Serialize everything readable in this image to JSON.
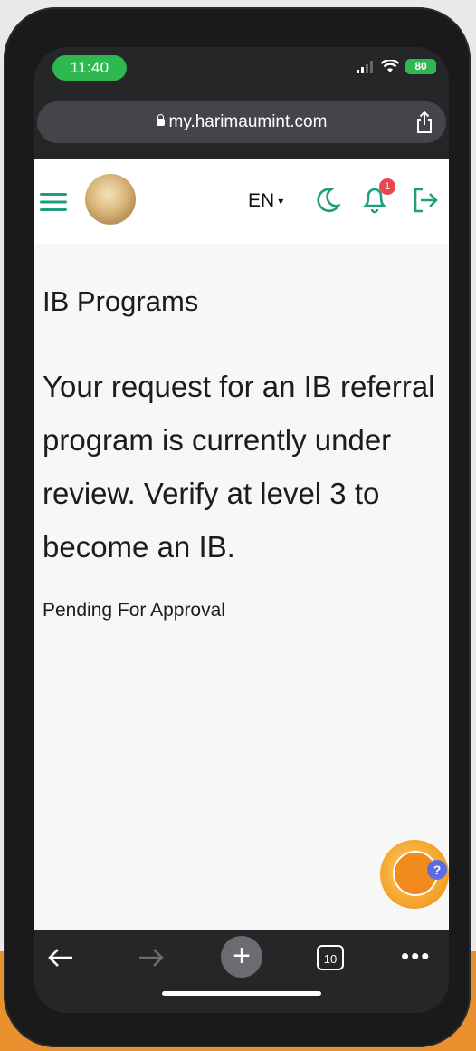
{
  "status_bar": {
    "time": "11:40",
    "battery": "80"
  },
  "browser": {
    "url": "my.harimaumint.com",
    "tab_count": "10"
  },
  "nav": {
    "language": "EN",
    "notification_count": "1"
  },
  "content": {
    "heading": "IB Programs",
    "message": "Your request for an IB referral program is currently under review. Verify at level 3 to become an IB.",
    "status": "Pending For Approval"
  },
  "chat": {
    "help_mark": "?"
  },
  "colors": {
    "accent_green": "#1e9e7e",
    "status_green": "#2fb84f",
    "badge_red": "#e5484d",
    "background_orange": "#e8902e"
  },
  "icons": [
    "lock-icon",
    "share-icon",
    "hamburger-icon",
    "moon-icon",
    "bell-icon",
    "logout-icon",
    "back-icon",
    "forward-icon",
    "plus-icon",
    "tabs-icon",
    "more-icon"
  ]
}
